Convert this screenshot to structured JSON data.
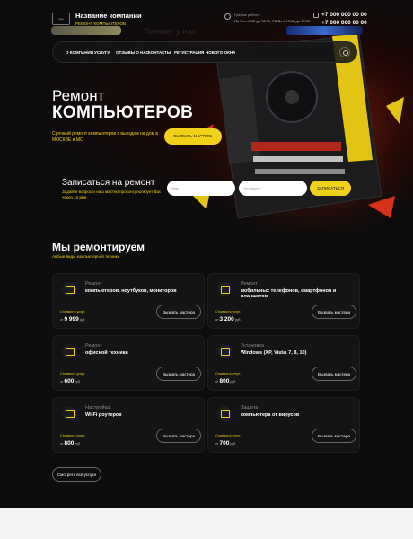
{
  "header": {
    "logo": "logo",
    "company_name": "Название компании",
    "company_sub": "РЕМОНТ КОМПЬЮТЕРОВ",
    "hours_label": "График работы",
    "hours_text": "Пн-Пт с 9:00 до 18:00, Сб-Вс с 10:00 до 17:00",
    "phone1": "+7 000 000 00 00",
    "phone2": "+7 000 000 00 00"
  },
  "nav": {
    "items": [
      "О КОМПАНИИ",
      "УСЛУГИ",
      "ОТЗЫВЫ О НАС",
      "КОНТАКТЫ",
      "РЕГИСТРАЦИЯ",
      "НОВОГО ОКНА"
    ]
  },
  "hero": {
    "title1": "Ремонт",
    "title2": "КОМПЬЮТЕРОВ",
    "desc": "Срочный ремонт компьютеров с выездом на дом в МОСКВЕ и МО",
    "cta": "ВЫЗВАТЬ МАСТЕРА"
  },
  "form": {
    "title": "Записаться на ремонт",
    "desc": "Задайте вопрос и наш мастер проконсультирует Вас через 10 мин",
    "name_placeholder": "Имя",
    "phone_placeholder": "Телефон *",
    "submit": "ЗАПИСАТЬСЯ"
  },
  "services": {
    "title": "Мы ремонтируем",
    "subtitle": "любые виды компьютерной техники",
    "cost_label": "Стоимость услуг:",
    "price_prefix": "от",
    "currency": "руб.",
    "button": "Вызвать мастера",
    "cards": [
      {
        "cat": "Ремонт",
        "name": "компьютеров, ноутбуков, мониторов",
        "price": "9 999"
      },
      {
        "cat": "Ремонт",
        "name": "мобильных телефонов, смартфонов и планшетов",
        "price": "3 200"
      },
      {
        "cat": "Ремонт",
        "name": "офисной техники",
        "price": "600"
      },
      {
        "cat": "Установка",
        "name": "Windows (XP, Vista, 7, 8, 10)",
        "price": "800"
      },
      {
        "cat": "Настройка",
        "name": "Wi-Fi роутеров",
        "price": "800"
      },
      {
        "cat": "Защита",
        "name": "компьютера от вирусов",
        "price": "700"
      }
    ],
    "all_button": "Смотреть все услуги"
  },
  "bottom": {
    "title": "Почему у нас"
  },
  "colors": {
    "accent": "#f1d21a",
    "background": "#0b0b0c"
  }
}
